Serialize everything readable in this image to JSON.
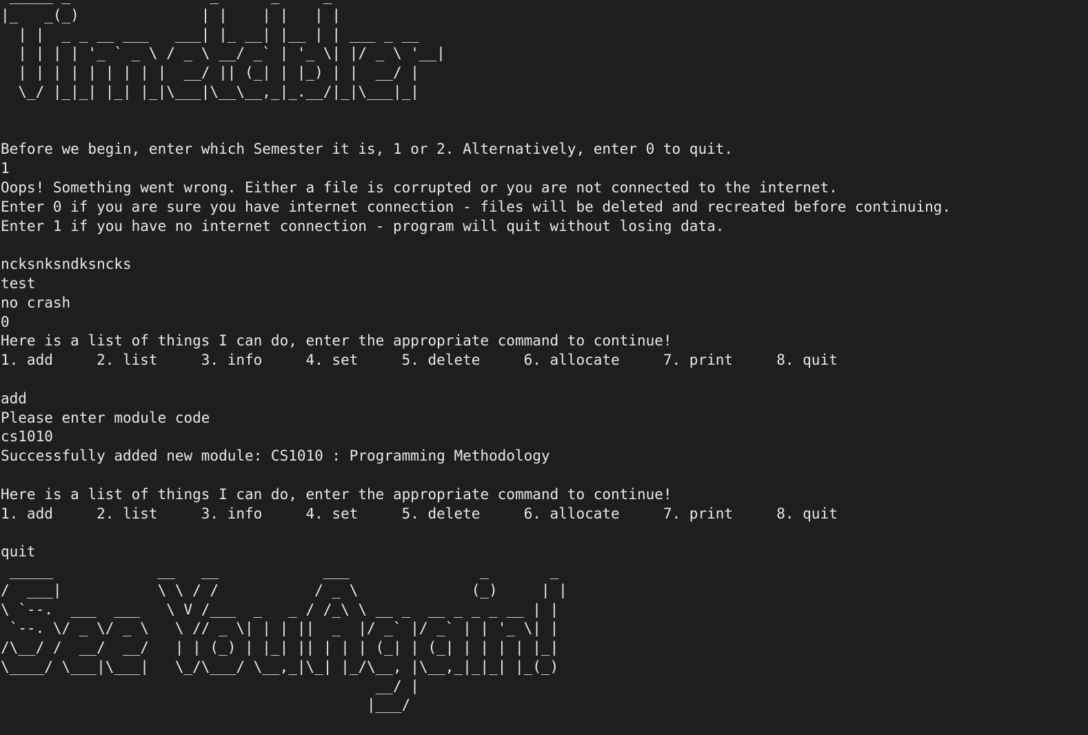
{
  "terminal": {
    "banner_top": " _____ _                _      _     _\n|_   _(_)              | |    | |   | |\n  | |  _ _ __ ___   ___| |_ __| |__ | | ___ _ __\n  | | | | '_ ` _ \\ / _ \\ __/ _` | '_ \\| |/ _ \\ '__|\n  | | | | | | | | |  __/ || (_| | |_) | |  __/ |\n  \\_/ |_|_| |_| |_|\\___|\\__\\__,_|_.__/|_|\\___|_|",
    "lines": [
      "Before we begin, enter which Semester it is, 1 or 2. Alternatively, enter 0 to quit.",
      "1",
      "Oops! Something went wrong. Either a file is corrupted or you are not connected to the internet.",
      "Enter 0 if you are sure you have internet connection - files will be deleted and recreated before continuing.",
      "Enter 1 if you have no internet connection - program will quit without losing data.",
      "",
      "ncksnksndksncks",
      "test",
      "no crash",
      "0",
      "Here is a list of things I can do, enter the appropriate command to continue!",
      "1. add     2. list     3. info     4. set     5. delete     6. allocate     7. print     8. quit",
      "",
      "add",
      "Please enter module code",
      "cs1010",
      "Successfully added new module: CS1010 : Programming Methodology",
      "",
      "Here is a list of things I can do, enter the appropriate command to continue!",
      "1. add     2. list     3. info     4. set     5. delete     6. allocate     7. print     8. quit",
      "",
      "quit"
    ],
    "banner_bottom": " _____            __   __            ___               _       _\n/  ___|           \\ \\ / /           / _ \\             (_)     | |\n\\ `--.  ___  ___   \\ V /___  _   _ / /_\\ \\ __ _  __ _ _ _ __ | |\n `--. \\/ _ \\/ _ \\   \\ // _ \\| | | ||  _  |/ _` |/ _` | | '_ \\| |\n/\\__/ /  __/  __/   | | (_) | |_| || | | | (_| | (_| | | | | |_|\n\\____/ \\___|\\___|   \\_/\\___/ \\__,_|\\_| |_/\\__, |\\__,_|_|_| |_(_)\n                                           __/ |\n                                          |___/"
  }
}
